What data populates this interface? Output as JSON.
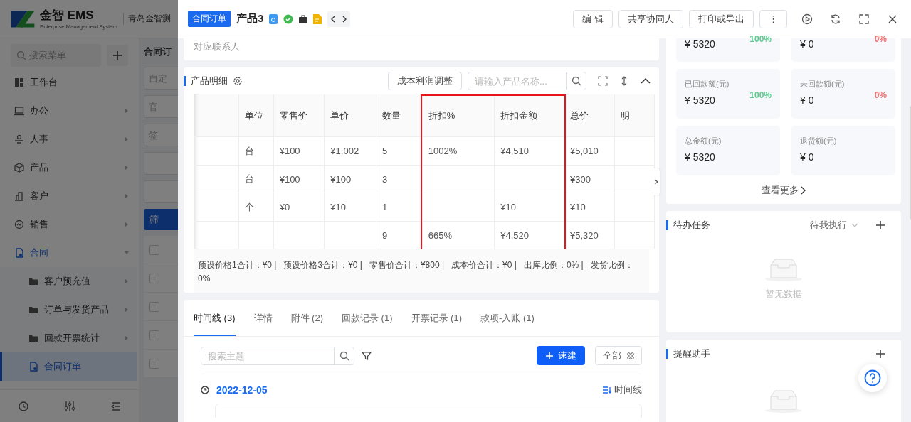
{
  "app": {
    "logo_name": "金智 EMS",
    "logo_subtitle": "Enterprise Management System",
    "company": "青岛金智测",
    "sidebar": {
      "search_placeholder": "搜索菜单",
      "items": [
        {
          "label": "工作台",
          "selected": false
        },
        {
          "label": "办公",
          "selected": false,
          "expanded": false
        },
        {
          "label": "人事",
          "selected": false,
          "expanded": false
        },
        {
          "label": "产品",
          "selected": false,
          "expanded": false
        },
        {
          "label": "客户",
          "selected": false,
          "expanded": false
        },
        {
          "label": "销售",
          "selected": false,
          "expanded": false
        },
        {
          "label": "合同",
          "selected": false,
          "expanded": true,
          "children": [
            {
              "label": "客户预充值",
              "selected": false,
              "expanded": false
            },
            {
              "label": "订单与发货产品",
              "selected": false,
              "expanded": false
            },
            {
              "label": "回款开票统计",
              "selected": false,
              "expanded": false
            },
            {
              "label": "合同订单",
              "selected": true
            }
          ]
        }
      ]
    },
    "page_title": "合同订",
    "filters": [
      {
        "kind": "field",
        "text": "自定"
      },
      {
        "kind": "field",
        "text": "官"
      },
      {
        "kind": "field",
        "text": "签"
      },
      {
        "kind": "blank"
      },
      {
        "kind": "blank"
      },
      {
        "kind": "button",
        "text": "筛"
      }
    ],
    "list_rows": [
      {
        "checked": false
      },
      {
        "checked": false
      },
      {
        "checked": false
      },
      {
        "checked": false
      },
      {
        "checked": false
      }
    ]
  },
  "drawer": {
    "tag": "合同订单",
    "title": "产品3",
    "actions": [
      "编 辑",
      "共享协同人",
      "打印或导出",
      "⋮"
    ],
    "contact_label": "对应联系人",
    "products": {
      "title": "产品明细",
      "adjust_button": "成本利润调整",
      "search_placeholder": "请输入产品名称...",
      "columns": [
        {
          "label": "单位",
          "highlighted": false
        },
        {
          "label": "零售价",
          "highlighted": false
        },
        {
          "label": "单价",
          "highlighted": false
        },
        {
          "label": "数量",
          "highlighted": false
        },
        {
          "label": "折扣%",
          "highlighted": true
        },
        {
          "label": "折扣金额",
          "highlighted": true
        },
        {
          "label": "总价",
          "highlighted": false
        },
        {
          "label": "明",
          "highlighted": false
        }
      ],
      "rows": [
        [
          "台",
          "¥100",
          "¥1,002",
          "5",
          "1002%",
          "¥4,510",
          "¥5,010",
          null
        ],
        [
          "台",
          "¥100",
          "¥100",
          "3",
          null,
          null,
          "¥300",
          null
        ],
        [
          "个",
          "¥0",
          "¥10",
          "1",
          null,
          "¥10",
          "¥10",
          null
        ],
        [
          null,
          null,
          null,
          "9",
          "665%",
          "¥4,520",
          "¥5,320",
          null
        ]
      ],
      "summary": "预设价格1合计：¥0 |   预设价格3合计：¥0 |   零售价合计：¥800 |   成本价合计：¥0 |   出库比例：0% |   发货比例：0%"
    },
    "activity": {
      "tabs": [
        {
          "label": "时间线 (3)",
          "selected": true
        },
        {
          "label": "详情",
          "selected": false
        },
        {
          "label": "附件 (2)",
          "selected": false
        },
        {
          "label": "回款记录 (1)",
          "selected": false
        },
        {
          "label": "开票记录 (1)",
          "selected": false
        },
        {
          "label": "款项-入账 (1)",
          "selected": false
        }
      ],
      "search_placeholder": "搜索主题",
      "quick_button": "速建",
      "all_button": "全部",
      "date": "2022-12-05",
      "view_label": "时间线"
    },
    "stats": [
      {
        "value": "¥ 5320",
        "ratio": "100%",
        "color": "#5ccb8f"
      },
      {
        "value": "¥ 0",
        "ratio": "0%",
        "color": "#f36c6c"
      },
      {
        "label": "已回款额(元)",
        "value": "¥ 5320",
        "ratio": "100%",
        "color": "#5ccb8f"
      },
      {
        "label": "未回款额(元)",
        "value": "¥ 0",
        "ratio": "0%",
        "color": "#f36c6c"
      },
      {
        "label": "总金额(元)",
        "value": "¥ 5320"
      },
      {
        "label": "退货额(元)",
        "value": "¥ 0"
      }
    ],
    "more_link": "查看更多",
    "tasks": {
      "title": "待办任务",
      "filter": "待我执行",
      "empty": "暂无数据"
    },
    "reminders": {
      "title": "提醒助手"
    }
  }
}
